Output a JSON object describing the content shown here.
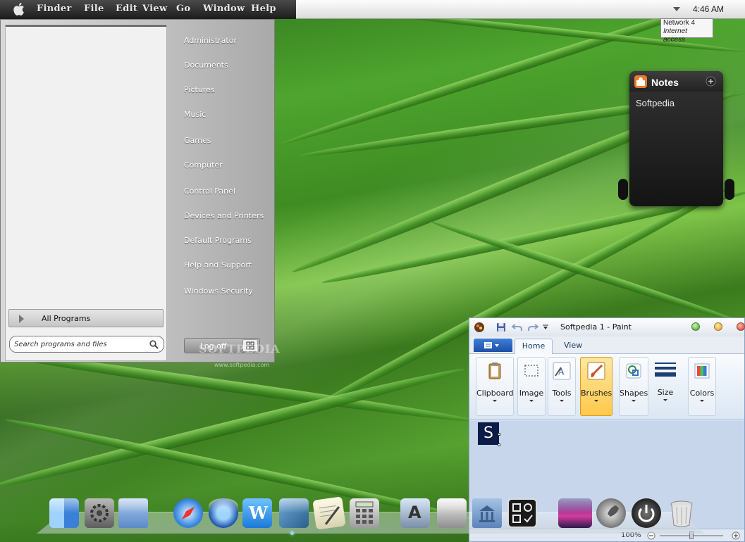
{
  "menubar": {
    "items": [
      "Finder",
      "File",
      "Edit",
      "View",
      "Go",
      "Window",
      "Help"
    ],
    "clock": "4:46 AM"
  },
  "network_tooltip": {
    "line1": "Network  4",
    "line2": "Internet access"
  },
  "start_menu": {
    "right_items": [
      "Administrator",
      "Documents",
      "Pictures",
      "Music",
      "Games",
      "Computer",
      "Control Panel",
      "Devices and Printers",
      "Default Programs",
      "Help and Support",
      "Windows Security"
    ],
    "all_programs": "All Programs",
    "search_placeholder": "Search programs and files",
    "log_off": "Log off"
  },
  "watermark": {
    "text": "SOFTPEDIA",
    "sub": "www.softpedia.com"
  },
  "notes_widget": {
    "title": "Notes",
    "text": "Softpedia"
  },
  "paint": {
    "title": "Softpedia 1 - Paint",
    "tabs": [
      "Home",
      "View"
    ],
    "groups": [
      "Clipboard",
      "Image",
      "Tools",
      "Brushes",
      "Shapes",
      "Size",
      "Colors"
    ],
    "canvas_text": "S",
    "zoom": "100%"
  },
  "dock": {
    "icons": [
      "finder-icon",
      "system-preferences-icon",
      "users-folder-icon",
      "safari-icon",
      "quicktime-icon",
      "word-icon",
      "iphoto-icon",
      "textedit-icon",
      "calculator-icon",
      "app-store-icon",
      "disk-utility-icon",
      "library-folder-icon",
      "dashboard-icon",
      "front-row-icon",
      "rocket-icon",
      "power-icon",
      "trash-icon"
    ]
  },
  "colors": {
    "accent": "#1c4fa8",
    "selection": "#ffc94a"
  }
}
